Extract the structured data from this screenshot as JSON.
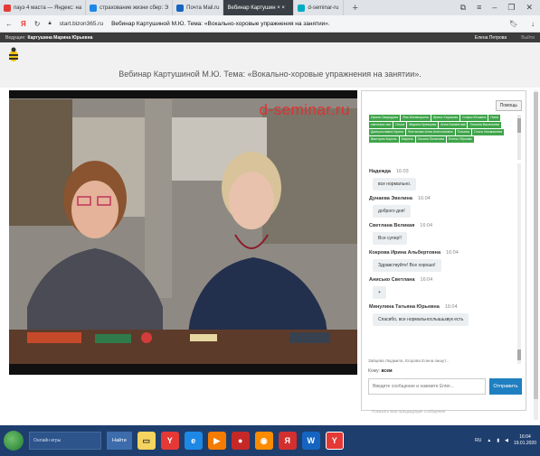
{
  "tabs": [
    {
      "label": "пауэ 4 маста — Яндекс: на",
      "color": "#e53935"
    },
    {
      "label": "страхование жизни сбер: Э",
      "color": "#1e88e5"
    },
    {
      "label": "Почта Mail.ru",
      "color": "#1565c0"
    },
    {
      "label": "Вебинар Картушин × ×",
      "color": "#ffffff",
      "active": true
    },
    {
      "label": "d-seminar-ru",
      "color": "#00acc1"
    }
  ],
  "new_tab": "+",
  "address": {
    "domain": "start.bizon365.ru",
    "page_title": "Вебинар Картушиной М.Ю. Тема: «Вокально-хоровые упражнения на занятии»."
  },
  "site_header": {
    "host_label": "Ведущие:",
    "host_name": "Картушина Марина Юрьевна",
    "user": "Елена Петрова",
    "logout": "Выйти"
  },
  "webinar_title": "Вебинар Картушиной М.Ю. Тема: «Вокально-хоровые упражнения на занятии».",
  "video": {
    "watermark": "d-seminar.ru"
  },
  "chat": {
    "help": "Помощь",
    "participants": [
      "Ирина Свиридова",
      "Яна Монмоцкина",
      "Ирина Харькова",
      "Софья Юсимна",
      "Нина",
      "светлана лян",
      "Ольга",
      "Марина Кривцова",
      "Анна Бахметова",
      "Татьяна Васильева",
      "Дмитрославна Ирина",
      "Фаттахова Анна Анатольевна",
      "Татьяна",
      "Ольга Химмашева",
      "Виктория Король",
      "Марина",
      "Оксана Пилатова",
      "Елена Обухова"
    ],
    "messages": [
      {
        "name": "Надежда",
        "time": "16:03",
        "text": "все нормально."
      },
      {
        "name": "Дунаева Эвелина",
        "time": "16:04",
        "text": "доброго дня!"
      },
      {
        "name": "Светлана Великая",
        "time": "16:04",
        "text": "Все супер!!"
      },
      {
        "name": "Кокрова Ирина Альбертовна",
        "time": "16:04",
        "text": "Здравствуйте! Все хорошо!"
      },
      {
        "name": "Анисько Светлана",
        "time": "16:04",
        "text": "+"
      },
      {
        "name": "Минулина Татьяна Юрьевна",
        "time": "16:04",
        "text": "Спасибо, все нормальнослышьзвук есть"
      }
    ],
    "typing": "Зайцева Людмила, Егорова Елена пишут...",
    "to_label": "Кому:",
    "to_value": "всем",
    "input_placeholder": "Введите сообщение и нажмите Enter...",
    "send": "Отправить",
    "history": "Показать мои предыдущие сообщения"
  },
  "taskbar": {
    "search_placeholder": "Онлайн игры",
    "search_go": "Найти",
    "tray_lang": "RU",
    "time": "16:04",
    "date": "19.01.2020"
  }
}
